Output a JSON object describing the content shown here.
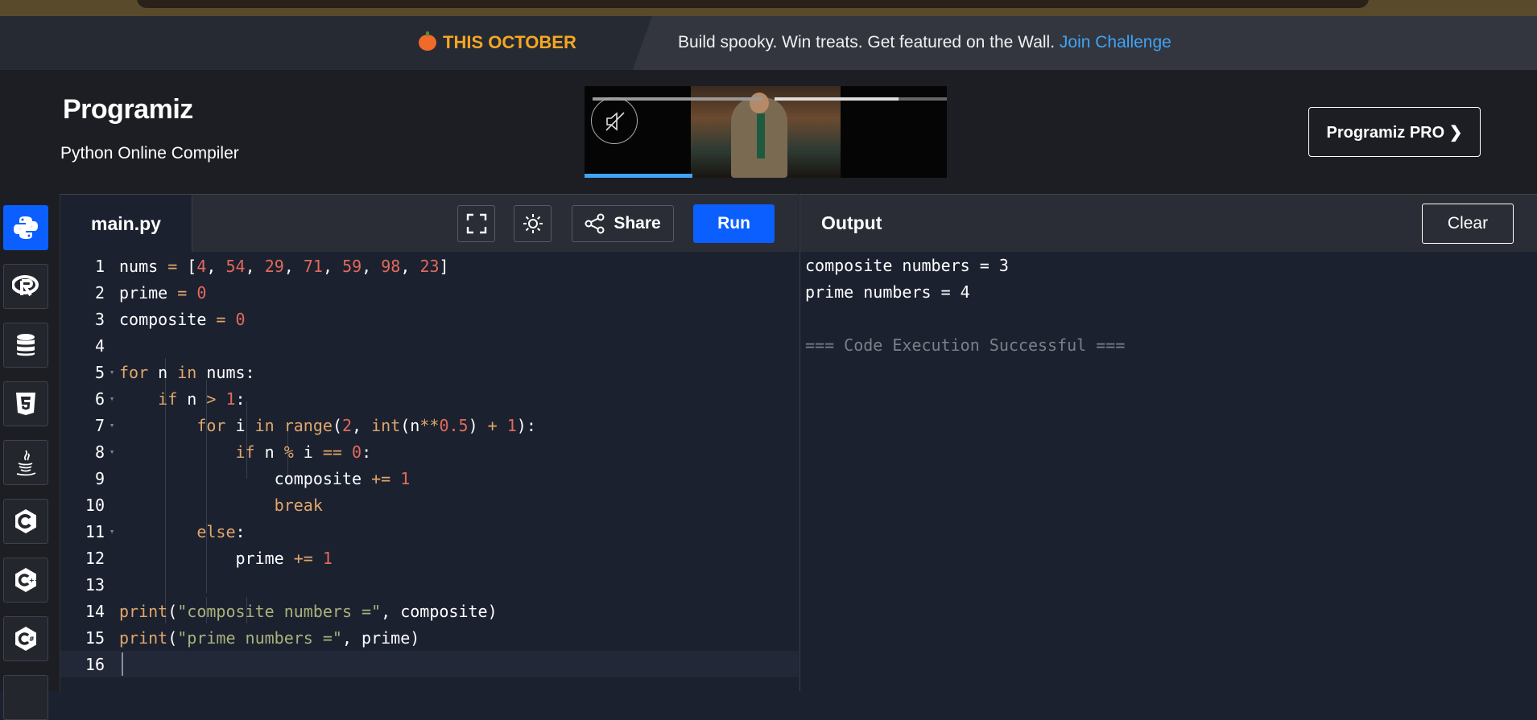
{
  "promo": {
    "badge": "THIS OCTOBER",
    "message": "Build spooky. Win treats. Get featured on the Wall.",
    "link": "Join Challenge"
  },
  "header": {
    "logo": "Programiz",
    "subtitle": "Python Online Compiler",
    "pro_button": "Programiz PRO ❯"
  },
  "languages": [
    {
      "name": "python-icon",
      "active": true
    },
    {
      "name": "r-icon"
    },
    {
      "name": "sql-database-icon"
    },
    {
      "name": "html5-icon"
    },
    {
      "name": "java-icon"
    },
    {
      "name": "c-icon"
    },
    {
      "name": "cpp-icon"
    },
    {
      "name": "csharp-icon"
    }
  ],
  "editor": {
    "tab": "main.py",
    "share_label": "Share",
    "run_label": "Run",
    "lines": [
      {
        "n": "1"
      },
      {
        "n": "2"
      },
      {
        "n": "3"
      },
      {
        "n": "4"
      },
      {
        "n": "5"
      },
      {
        "n": "6"
      },
      {
        "n": "7"
      },
      {
        "n": "8"
      },
      {
        "n": "9"
      },
      {
        "n": "10"
      },
      {
        "n": "11"
      },
      {
        "n": "12"
      },
      {
        "n": "13"
      },
      {
        "n": "14"
      },
      {
        "n": "15"
      },
      {
        "n": "16"
      }
    ],
    "code": [
      "nums = [4, 54, 29, 71, 59, 98, 23]",
      "prime = 0",
      "composite = 0",
      "",
      "for n in nums:",
      "    if n > 1:",
      "        for i in range(2, int(n**0.5) + 1):",
      "            if n % i == 0:",
      "                composite += 1",
      "                break",
      "        else:",
      "            prime += 1",
      "",
      "print(\"composite numbers =\", composite)",
      "print(\"prime numbers =\", prime)",
      ""
    ]
  },
  "output": {
    "title": "Output",
    "clear_label": "Clear",
    "lines": [
      "composite numbers = 3",
      "prime numbers = 4",
      "",
      "=== Code Execution Successful ==="
    ]
  }
}
